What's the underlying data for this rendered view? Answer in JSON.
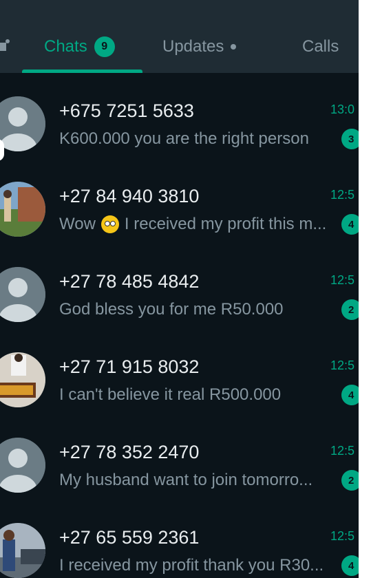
{
  "tabs": {
    "chats": {
      "label": "Chats",
      "badge": "9"
    },
    "updates": {
      "label": "Updates"
    },
    "calls": {
      "label": "Calls"
    }
  },
  "chats": [
    {
      "name": "+675 7251 5633",
      "message": "K600.000 you are the right person",
      "time": "13:0",
      "unread": "3",
      "avatar": "default-avatar-icon"
    },
    {
      "name": "+27 84 940 3810",
      "message_before": "Wow",
      "emoji": "flushed-face-emoji",
      "message_after": "I received my profit this m...",
      "time": "12:5",
      "unread": "4",
      "avatar": "outdoor-photo-avatar"
    },
    {
      "name": "+27 78 485 4842",
      "message": "God bless you for me R50.000",
      "time": "12:5",
      "unread": "2",
      "avatar": "default-avatar-icon"
    },
    {
      "name": "+27 71 915 8032",
      "message": "I can't believe it real R500.000",
      "time": "12:5",
      "unread": "4",
      "avatar": "food-photo-avatar"
    },
    {
      "name": "+27 78 352 2470",
      "message": "My husband want to join tomorro...",
      "time": "12:5",
      "unread": "2",
      "avatar": "default-avatar-icon"
    },
    {
      "name": "+27 65 559 2361",
      "message": "I received my profit thank you R30...",
      "time": "12:5",
      "unread": "4",
      "avatar": "person-photo-avatar"
    }
  ],
  "colors": {
    "accent": "#00a884",
    "background": "#0b141a",
    "header": "#1f2c34",
    "text_primary": "#e9edef",
    "text_secondary": "#8696a0"
  }
}
